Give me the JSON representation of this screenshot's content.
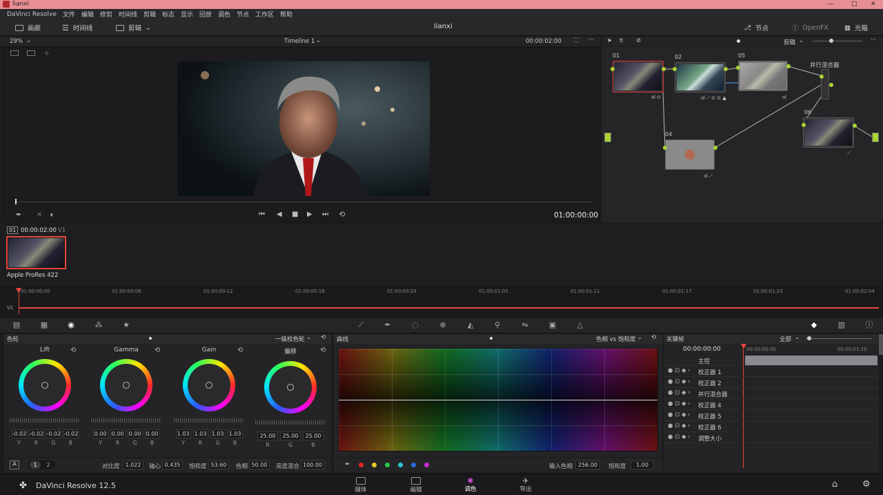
{
  "window": {
    "title": "lianxi",
    "controls": [
      "—",
      "□",
      "✕"
    ]
  },
  "menu": [
    "DaVinci Resolve",
    "文件",
    "编辑",
    "修剪",
    "时间线",
    "剪辑",
    "标志",
    "显示",
    "回放",
    "调色",
    "节点",
    "工作区",
    "帮助"
  ],
  "topbar": {
    "gallery": "画廊",
    "timelines": "时间线",
    "clips": "剪辑",
    "project": "lianxi",
    "nodes": "节点",
    "openfx": "OpenFX",
    "lightbox": "光箱"
  },
  "viewer": {
    "zoom": "29%",
    "timeline_name": "Timeline 1",
    "timecode_top": "00:00:02:00",
    "timecode": "01:00:00:00"
  },
  "nodegraph": {
    "mode": "剪辑",
    "parallel_mixer": "并行混合器",
    "nodes": [
      {
        "id": "01",
        "badges": "ııl ⊙"
      },
      {
        "id": "02",
        "badges": "ııl ⟋ ⊙ ⊙ ▲"
      },
      {
        "id": "05",
        "badges": "ııl"
      },
      {
        "id": "04",
        "badges": "ııl ⟋"
      },
      {
        "id": "06",
        "badges": "⟋"
      }
    ]
  },
  "clip": {
    "index": "01",
    "timecode": "00:00:02:00",
    "track": "V1",
    "codec": "Apple ProRes 422"
  },
  "timeline": {
    "track": "V1",
    "ticks": [
      "01:00:00:00",
      "01:00:00:06",
      "01:00:00:12",
      "01:00:00:18",
      "01:00:00:24",
      "01:00:01:05",
      "01:00:01:11",
      "01:00:01:17",
      "01:00:01:23",
      "01:00:02:04"
    ]
  },
  "wheels": {
    "title": "色轮",
    "mode": "一级校色轮",
    "items": [
      {
        "label": "Lift",
        "values": [
          "-0.02",
          "-0.02",
          "-0.02",
          "-0.02"
        ],
        "channels": [
          "Y",
          "R",
          "G",
          "B"
        ]
      },
      {
        "label": "Gamma",
        "values": [
          "0.00",
          "0.00",
          "0.00",
          "0.00"
        ],
        "channels": [
          "Y",
          "R",
          "G",
          "B"
        ]
      },
      {
        "label": "Gain",
        "values": [
          "1.03",
          "1.03",
          "1.03",
          "1.03"
        ],
        "channels": [
          "Y",
          "R",
          "G",
          "B"
        ]
      },
      {
        "label": "偏移",
        "values": [
          "25.00",
          "25.00",
          "25.00"
        ],
        "channels": [
          "R",
          "G",
          "B"
        ]
      }
    ],
    "footer": {
      "a": "A",
      "p1": "1",
      "p2": "2",
      "contrast_label": "对比度",
      "contrast": "1.022",
      "pivot_label": "轴心",
      "pivot": "0.435",
      "sat_label": "饱和度",
      "sat": "53.60",
      "hue_label": "色相",
      "hue": "50.00",
      "lummix_label": "亮度混合",
      "lummix": "100.00"
    }
  },
  "curves": {
    "title": "曲线",
    "mode": "色相 vs 饱和度",
    "input_hue_label": "输入色相",
    "input_hue": "256.00",
    "sat_label": "饱和度",
    "sat": "1.00",
    "swatches": [
      "#e02a2a",
      "#e0c72a",
      "#2ac74a",
      "#2ac7d6",
      "#2a6ae0",
      "#c72ad6"
    ]
  },
  "keyframes": {
    "title": "关键帧",
    "filter": "全部",
    "timecode": "00:00:00:00",
    "tc_right": "00:00:01:10",
    "tc_left": "00:00:00:00",
    "master": "主控",
    "rows": [
      "校正器 1",
      "校正器 2",
      "并行混合器",
      "校正器 4",
      "校正器 5",
      "校正器 6",
      "调整大小"
    ]
  },
  "pages": {
    "app_name": "DaVinci Resolve 12.5",
    "items": [
      "媒体",
      "编辑",
      "调色",
      "导出"
    ],
    "active": "调色"
  },
  "colors": {
    "accent": "#e8463a",
    "node_green": "#a9d434",
    "page_active": "#cc4fd9"
  }
}
